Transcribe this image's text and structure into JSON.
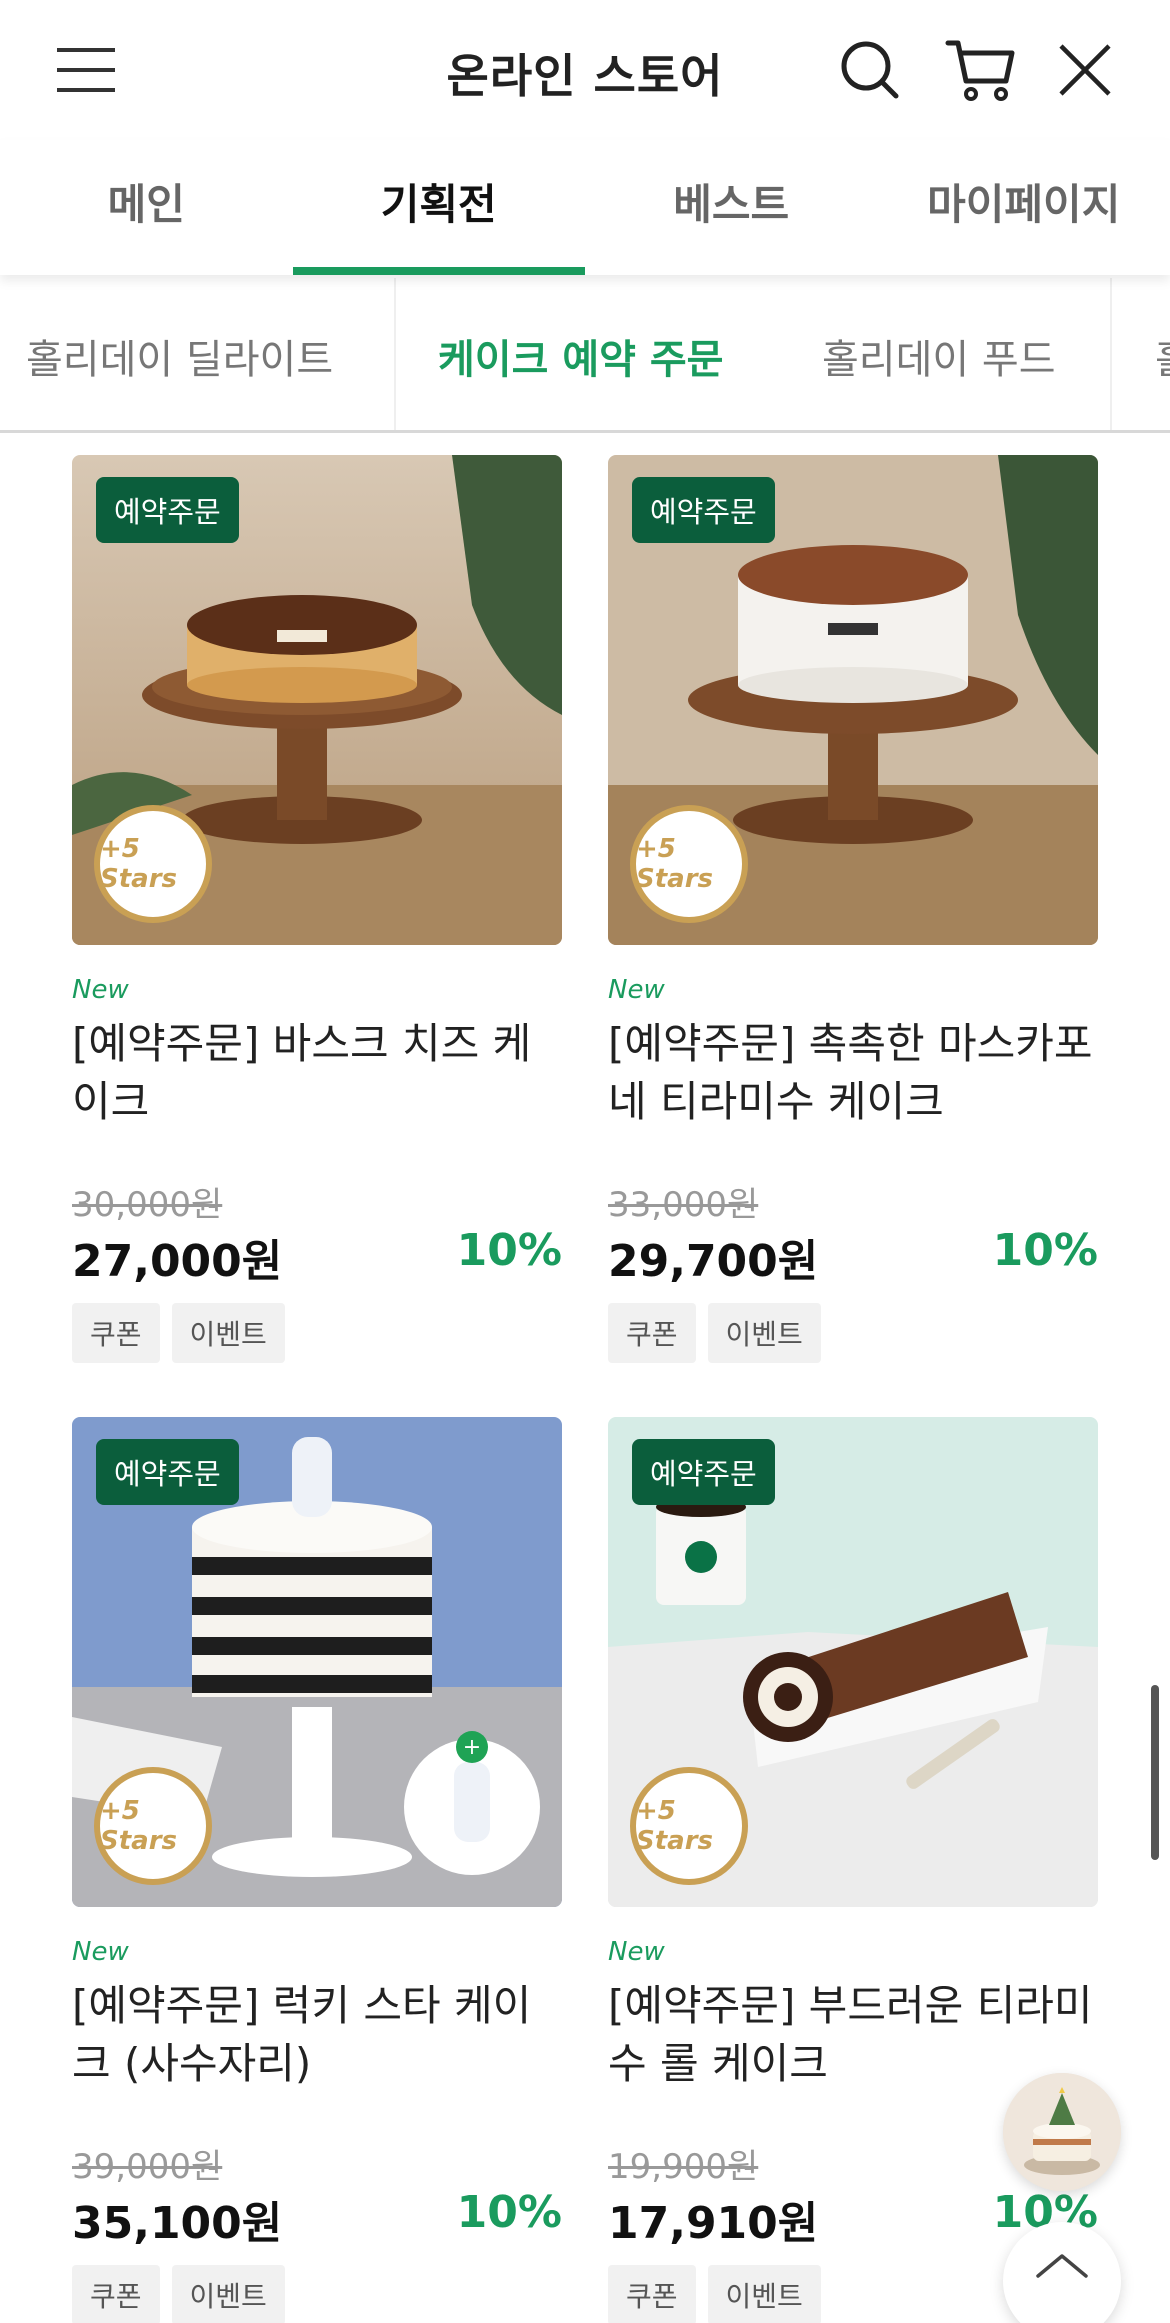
{
  "header": {
    "title": "온라인 스토어",
    "icons": [
      "menu-icon",
      "search-icon",
      "cart-icon",
      "close-icon"
    ]
  },
  "main_tabs": [
    {
      "label": "메인",
      "active": false
    },
    {
      "label": "기획전",
      "active": true
    },
    {
      "label": "베스트",
      "active": false
    },
    {
      "label": "마이페이지",
      "active": false
    }
  ],
  "sub_tabs": [
    {
      "label": "홀리데이 딜라이트",
      "active": false
    },
    {
      "label": "케이크 예약 주문",
      "active": true
    },
    {
      "label": "홀리데이 푸드",
      "active": false
    },
    {
      "label": "홀",
      "active": false
    }
  ],
  "products": [
    {
      "badge": "예약주문",
      "stars": "+5 Stars",
      "new": "New",
      "name": "[예약주문] 바스크 치즈 케이크",
      "old_price": "30,000원",
      "price": "27,000원",
      "discount": "10%",
      "tags": [
        "쿠폰",
        "이벤트"
      ]
    },
    {
      "badge": "예약주문",
      "stars": "+5 Stars",
      "new": "New",
      "name": "[예약주문] 촉촉한 마스카포네 티라미수 케이크",
      "old_price": "33,000원",
      "price": "29,700원",
      "discount": "10%",
      "tags": [
        "쿠폰",
        "이벤트"
      ]
    },
    {
      "badge": "예약주문",
      "stars": "+5 Stars",
      "new": "New",
      "name": "[예약주문] 럭키 스타 케이크 (사수자리)",
      "old_price": "39,000원",
      "price": "35,100원",
      "discount": "10%",
      "tags": [
        "쿠폰",
        "이벤트"
      ]
    },
    {
      "badge": "예약주문",
      "stars": "+5 Stars",
      "new": "New",
      "name": "[예약주문] 부드러운 티라미수 롤 케이크",
      "old_price": "19,900원",
      "price": "17,910원",
      "discount": "10%",
      "tags": [
        "쿠폰",
        "이벤트"
      ]
    }
  ],
  "colors": {
    "accent": "#1a9b5e",
    "badge_bg": "#0b5e3c",
    "stars_gold": "#c9a054"
  }
}
